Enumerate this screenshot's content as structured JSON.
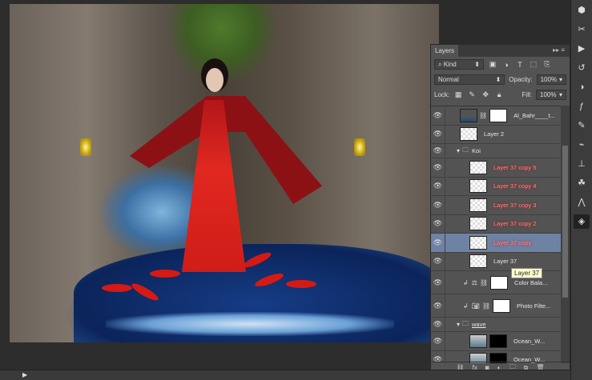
{
  "layers_panel": {
    "tab": "Layers",
    "filter_kind": "Kind",
    "blend_mode": "Normal",
    "opacity_label": "Opacity:",
    "opacity": "100%",
    "lock_label": "Lock:",
    "fill_label": "Fill:",
    "fill": "100%",
    "layers": [
      {
        "name": "Al_Bahr____t...",
        "type": "masked"
      },
      {
        "name": "Layer 2",
        "type": "pixel"
      },
      {
        "name": "Koi",
        "type": "group"
      },
      {
        "name": "Layer 37 copy 5",
        "type": "pixel"
      },
      {
        "name": "Layer 37 copy 4",
        "type": "pixel"
      },
      {
        "name": "Layer 37 copy 3",
        "type": "pixel"
      },
      {
        "name": "Layer 37 copy 2",
        "type": "pixel"
      },
      {
        "name": "Layer 37 copy",
        "type": "pixel",
        "selected": true
      },
      {
        "name": "Layer 37",
        "type": "pixel"
      },
      {
        "name": "Color Bala...",
        "type": "adjustment"
      },
      {
        "name": "Photo Filte...",
        "type": "adjustment"
      },
      {
        "name": "wave",
        "type": "group"
      },
      {
        "name": "Ocean_W...",
        "type": "masked"
      },
      {
        "name": "Ocean_W...",
        "type": "masked"
      }
    ]
  },
  "tooltip": "Layer 37"
}
